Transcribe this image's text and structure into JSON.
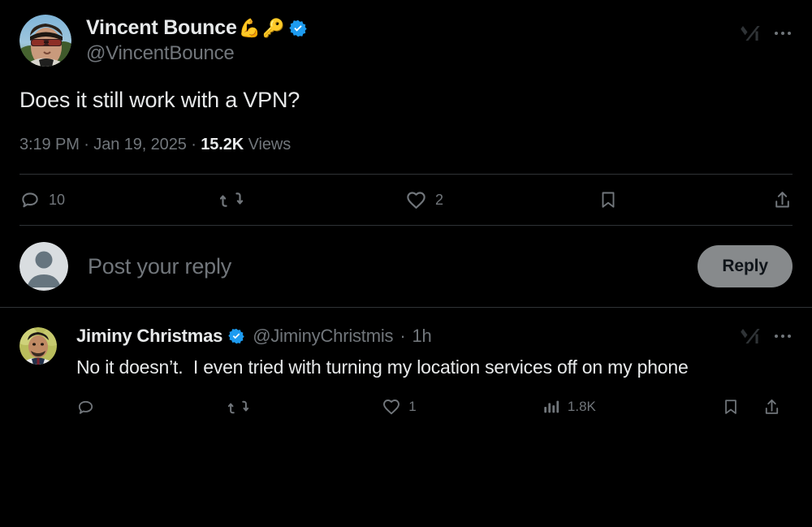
{
  "theme": {
    "background": "#000000",
    "text_primary": "#e7e9ea",
    "text_secondary": "#71767b",
    "divider": "#2f3336",
    "verified_blue": "#1d9bf0",
    "reply_button_bg": "#878a8c",
    "reply_button_text": "#0f1419"
  },
  "main_tweet": {
    "display_name": "Vincent Bounce",
    "name_emoji_bicep": "💪",
    "name_emoji_key": "🔑",
    "verified_icon": "verified-badge-icon",
    "handle": "@VincentBounce",
    "grok_icon": "grok-xai-icon",
    "more_icon": "more-options-icon",
    "body_text": "Does it still work with a VPN?",
    "time": "3:19 PM",
    "separator_1": "·",
    "date": "Jan 19, 2025",
    "separator_2": "·",
    "views_count": "15.2K",
    "views_label": "Views",
    "actions": {
      "reply": {
        "icon": "reply-icon",
        "count": "10"
      },
      "retweet": {
        "icon": "retweet-icon",
        "count": ""
      },
      "like": {
        "icon": "like-heart-icon",
        "count": "2"
      },
      "bookmark": {
        "icon": "bookmark-icon",
        "count": ""
      },
      "share": {
        "icon": "share-icon",
        "count": ""
      }
    }
  },
  "composer": {
    "avatar_icon": "default-avatar-icon",
    "placeholder": "Post your reply",
    "reply_button_label": "Reply"
  },
  "reply_tweet": {
    "display_name": "Jiminy Christmas",
    "verified_icon": "verified-badge-icon",
    "handle": "@JiminyChristmis",
    "time_separator": "·",
    "timestamp": "1h",
    "grok_icon": "grok-xai-icon",
    "more_icon": "more-options-icon",
    "body_text": "No it doesn’t.  I even tried with turning my location services off on my phone",
    "actions": {
      "reply": {
        "icon": "reply-icon",
        "count": ""
      },
      "retweet": {
        "icon": "retweet-icon",
        "count": ""
      },
      "like": {
        "icon": "like-heart-icon",
        "count": "1"
      },
      "views": {
        "icon": "analytics-bar-icon",
        "count": "1.8K"
      },
      "bookmark": {
        "icon": "bookmark-icon",
        "count": ""
      },
      "share": {
        "icon": "share-icon",
        "count": ""
      }
    }
  }
}
